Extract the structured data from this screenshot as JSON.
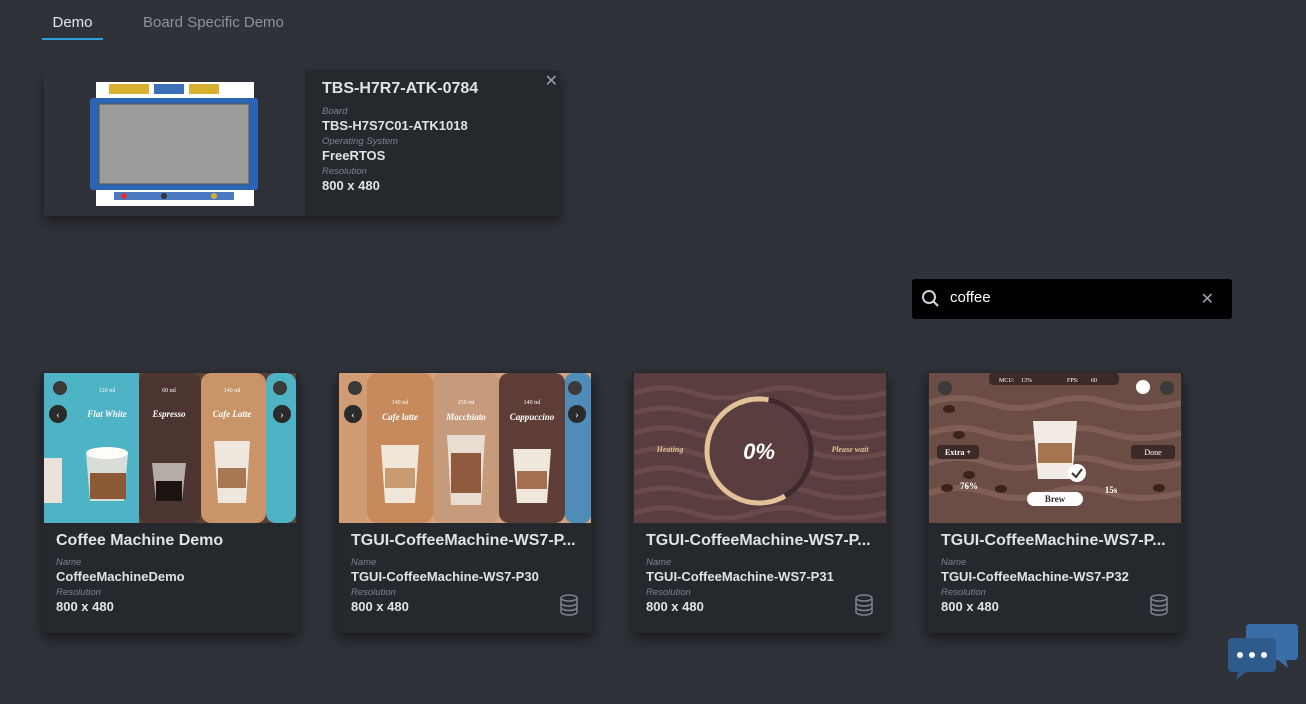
{
  "tabs": [
    {
      "label": "Demo"
    },
    {
      "label": "Board Specific Demo"
    }
  ],
  "board": {
    "title": "TBS-H7R7-ATK-0784",
    "board_label": "Board",
    "board_value": "TBS-H7S7C01-ATK1018",
    "os_label": "Operating System",
    "os_value": "FreeRTOS",
    "res_label": "Resolution",
    "res_value": "800 x 480",
    "close": "✕"
  },
  "search": {
    "value": "coffee",
    "clear": "✕"
  },
  "cards": [
    {
      "title": "Coffee Machine Demo",
      "name_label": "Name",
      "name": "CoffeeMachineDemo",
      "res_label": "Resolution",
      "res": "800 x 480",
      "thumb": {
        "t1": "120 ml",
        "t2": "60 ml",
        "t3": "140 ml",
        "n1": "Flat White",
        "n2": "Espresso",
        "n3": "Cafe Latte"
      }
    },
    {
      "title": "TGUI-CoffeeMachine-WS7-P...",
      "name_label": "Name",
      "name": "TGUI-CoffeeMachine-WS7-P30",
      "res_label": "Resolution",
      "res": "800 x 480",
      "thumb": {
        "t1": "140 ml",
        "t2": "250 ml",
        "t3": "140 ml",
        "n1": "Cafe latte",
        "n2": "Macchiato",
        "n3": "Cappuccino"
      }
    },
    {
      "title": "TGUI-CoffeeMachine-WS7-P...",
      "name_label": "Name",
      "name": "TGUI-CoffeeMachine-WS7-P31",
      "res_label": "Resolution",
      "res": "800 x 480",
      "thumb": {
        "left": "Heating",
        "center": "0%",
        "right": "Please wait"
      }
    },
    {
      "title": "TGUI-CoffeeMachine-WS7-P...",
      "name_label": "Name",
      "name": "TGUI-CoffeeMachine-WS7-P32",
      "res_label": "Resolution",
      "res": "800 x 480",
      "thumb": {
        "mcu": "MCU:",
        "mcu_v": "13%",
        "fps": "FPS:",
        "fps_v": "60",
        "extra": "Extra +",
        "done": "Done",
        "pct": "76%",
        "brew": "Brew",
        "time": "15s"
      }
    }
  ],
  "colors": {
    "accent": "#2a9fd8",
    "bg": "#2f3238",
    "card": "#25282d"
  },
  "icons": [
    "search-icon",
    "close-icon",
    "database-icon",
    "home-icon",
    "info-icon",
    "chevron-left-icon",
    "chevron-right-icon",
    "chat-icon"
  ]
}
